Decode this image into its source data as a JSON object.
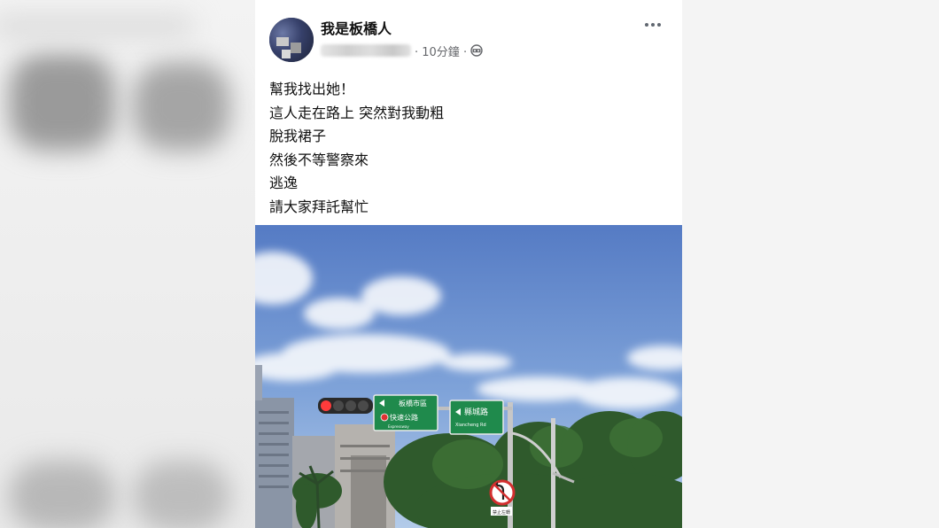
{
  "post": {
    "author": "我是板橋人",
    "time": "· 10分鐘 ·",
    "lines": [
      "幫我找出她！",
      "這人走在路上 突然對我動粗",
      "脫我裙子",
      "然後不等警察來",
      "逃逸",
      "請大家拜託幫忙"
    ],
    "audience_icon": "globe-icon",
    "more_icon": "more-options-icon"
  },
  "photo": {
    "sign_left_top": "板橋市區",
    "sign_left_bottom": "快速公路",
    "sign_left_bottom_sub": "Expressway",
    "sign_right_top": "縣城路",
    "sign_right_bottom": "Xiancheng Rd",
    "small_sign": "禁止左轉"
  },
  "colors": {
    "sky_top": "#5d82c8",
    "sky_bottom": "#a9c4e8",
    "sign_green": "#1f8a4c",
    "text": "#111111",
    "meta": "#65676b"
  }
}
